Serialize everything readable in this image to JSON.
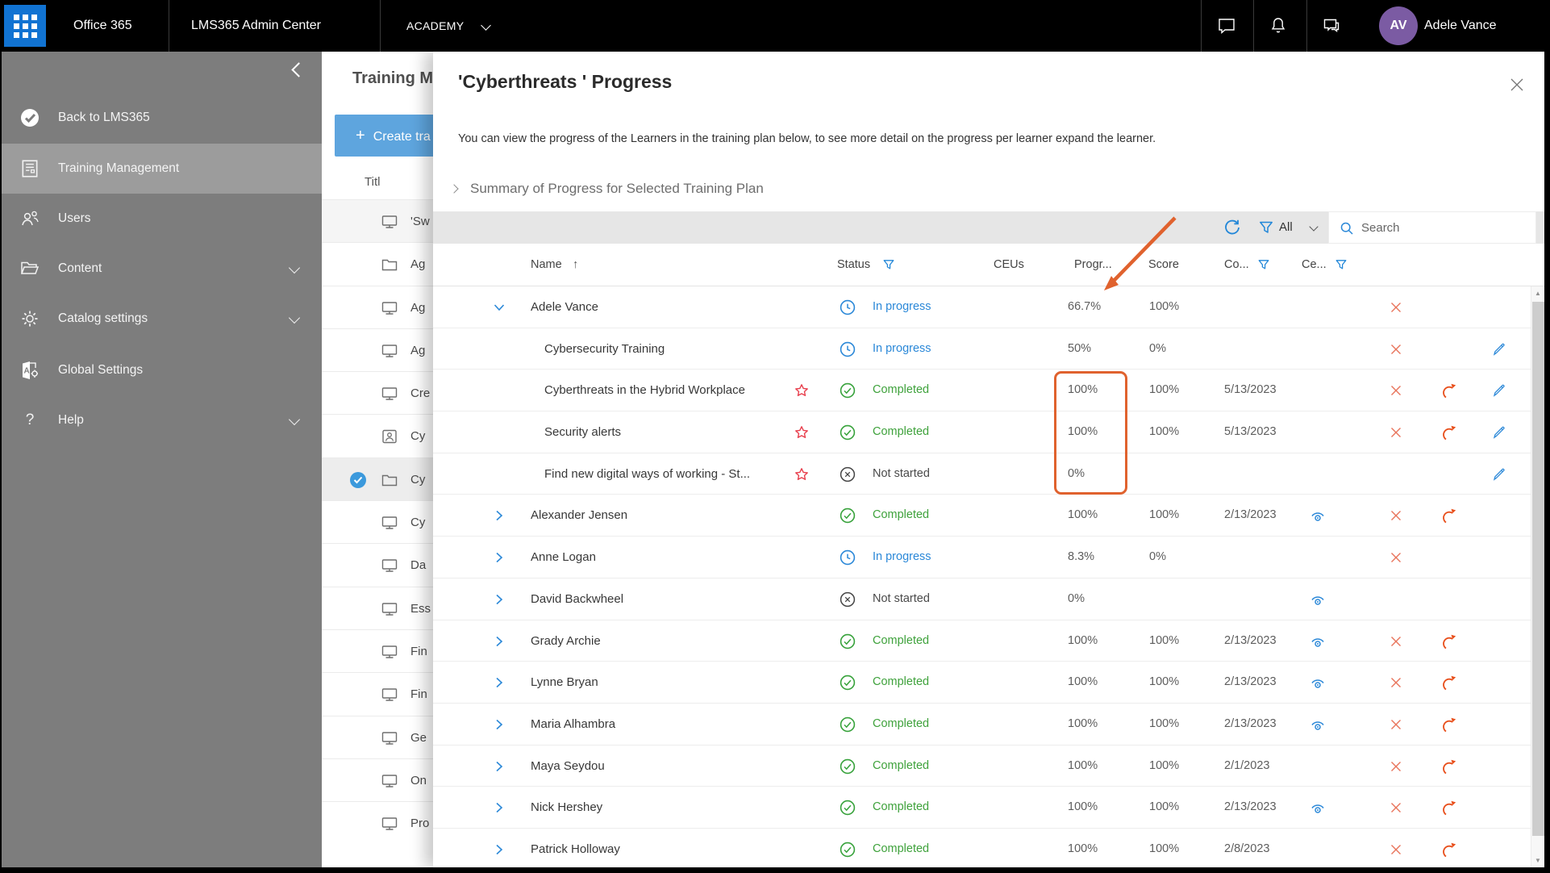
{
  "colors": {
    "accent_blue": "#2b88d8",
    "completed_green": "#3fa23c",
    "not_started_dark": "#4a4a4a",
    "remove_red": "#e8735a",
    "retake_orange": "#e84e1a",
    "annotation_orange": "#e0622e",
    "star_red": "#e8404e",
    "tile_blue": "#1173d2",
    "sidebar_gray": "#7d7d7d",
    "create_button_blue": "#5ea5de",
    "toolbar_gray": "#e6e6e6",
    "avatar_purple": "#7b5ba3"
  },
  "topbar": {
    "brand": "Office 365",
    "admin_center": "LMS365 Admin Center",
    "tenant": "ACADEMY",
    "user": {
      "initials": "AV",
      "name": "Adele Vance"
    }
  },
  "sidebar": {
    "items": [
      {
        "label": "Back to LMS365",
        "icon": "lms365-logo-icon"
      },
      {
        "label": "Training Management",
        "icon": "training-doc-icon",
        "selected": true
      },
      {
        "label": "Users",
        "icon": "users-icon"
      },
      {
        "label": "Content",
        "icon": "folder-icon",
        "expandable": true
      },
      {
        "label": "Catalog settings",
        "icon": "gear-icon",
        "expandable": true
      },
      {
        "label": "Global Settings",
        "icon": "global-settings-icon"
      },
      {
        "label": "Help",
        "icon": "help-icon",
        "expandable": true
      }
    ]
  },
  "training_list": {
    "title": "Training M",
    "create_button": "Create tra",
    "column_header": "Titl",
    "rows": [
      {
        "icon": "monitor",
        "text": "'Sw",
        "highlighted": true
      },
      {
        "icon": "folder",
        "text": "Ag"
      },
      {
        "icon": "monitor",
        "text": "Ag"
      },
      {
        "icon": "monitor",
        "text": "Ag"
      },
      {
        "icon": "monitor",
        "text": "Cre"
      },
      {
        "icon": "person",
        "text": "Cy"
      },
      {
        "icon": "folder",
        "text": "Cy",
        "selected": true
      },
      {
        "icon": "monitor",
        "text": "Cy"
      },
      {
        "icon": "monitor",
        "text": "Da"
      },
      {
        "icon": "monitor",
        "text": "Ess"
      },
      {
        "icon": "monitor",
        "text": "Fin"
      },
      {
        "icon": "monitor",
        "text": "Fin"
      },
      {
        "icon": "monitor",
        "text": "Ge"
      },
      {
        "icon": "monitor",
        "text": "On"
      },
      {
        "icon": "monitor",
        "text": "Pro"
      }
    ]
  },
  "panel": {
    "title": "'Cyberthreats ' Progress",
    "description": "You can view the progress of the Learners in the training plan below, to see more detail on the progress per learner expand the learner.",
    "summary_toggle": "Summary of Progress for Selected Training Plan",
    "toolbar": {
      "filter_label": "All",
      "search_placeholder": "Search"
    },
    "table": {
      "header": {
        "name": "Name",
        "sort_indicator": "↑",
        "status": "Status",
        "ceus": "CEUs",
        "progress": "Progr...",
        "score": "Score",
        "completion": "Co...",
        "certificate": "Ce..."
      },
      "rows": [
        {
          "expand": "expanded",
          "level": 0,
          "name": "Adele Vance",
          "star": false,
          "status_type": "in_progress",
          "status": "In progress",
          "progress": "66.7%",
          "score": "100%",
          "date": "",
          "eye": false,
          "x": true,
          "redo": false,
          "pencil": false
        },
        {
          "expand": "",
          "level": 1,
          "name": "Cybersecurity Training",
          "star": false,
          "status_type": "in_progress",
          "status": "In progress",
          "progress": "50%",
          "score": "0%",
          "date": "",
          "eye": false,
          "x": true,
          "redo": false,
          "pencil": true
        },
        {
          "expand": "",
          "level": 1,
          "name": "Cyberthreats in the Hybrid Workplace",
          "star": true,
          "status_type": "completed",
          "status": "Completed",
          "progress": "100%",
          "score": "100%",
          "date": "5/13/2023",
          "eye": false,
          "x": true,
          "redo": true,
          "pencil": true
        },
        {
          "expand": "",
          "level": 1,
          "name": "Security alerts",
          "star": true,
          "status_type": "completed",
          "status": "Completed",
          "progress": "100%",
          "score": "100%",
          "date": "5/13/2023",
          "eye": false,
          "x": true,
          "redo": true,
          "pencil": true
        },
        {
          "expand": "",
          "level": 1,
          "name": "Find new digital ways of working - St...",
          "star": true,
          "status_type": "not_started",
          "status": "Not started",
          "progress": "0%",
          "score": "",
          "date": "",
          "eye": false,
          "x": false,
          "redo": false,
          "pencil": true
        },
        {
          "expand": "collapsed",
          "level": 0,
          "name": "Alexander Jensen",
          "star": false,
          "status_type": "completed",
          "status": "Completed",
          "progress": "100%",
          "score": "100%",
          "date": "2/13/2023",
          "eye": true,
          "x": true,
          "redo": true,
          "pencil": false
        },
        {
          "expand": "collapsed",
          "level": 0,
          "name": "Anne Logan",
          "star": false,
          "status_type": "in_progress",
          "status": "In progress",
          "progress": "8.3%",
          "score": "0%",
          "date": "",
          "eye": false,
          "x": true,
          "redo": false,
          "pencil": false
        },
        {
          "expand": "collapsed",
          "level": 0,
          "name": "David Backwheel",
          "star": false,
          "status_type": "not_started",
          "status": "Not started",
          "progress": "0%",
          "score": "",
          "date": "",
          "eye": true,
          "x": false,
          "redo": false,
          "pencil": false
        },
        {
          "expand": "collapsed",
          "level": 0,
          "name": "Grady Archie",
          "star": false,
          "status_type": "completed",
          "status": "Completed",
          "progress": "100%",
          "score": "100%",
          "date": "2/13/2023",
          "eye": true,
          "x": true,
          "redo": true,
          "pencil": false
        },
        {
          "expand": "collapsed",
          "level": 0,
          "name": "Lynne Bryan",
          "star": false,
          "status_type": "completed",
          "status": "Completed",
          "progress": "100%",
          "score": "100%",
          "date": "2/13/2023",
          "eye": true,
          "x": true,
          "redo": true,
          "pencil": false
        },
        {
          "expand": "collapsed",
          "level": 0,
          "name": "Maria Alhambra",
          "star": false,
          "status_type": "completed",
          "status": "Completed",
          "progress": "100%",
          "score": "100%",
          "date": "2/13/2023",
          "eye": true,
          "x": true,
          "redo": true,
          "pencil": false
        },
        {
          "expand": "collapsed",
          "level": 0,
          "name": "Maya Seydou",
          "star": false,
          "status_type": "completed",
          "status": "Completed",
          "progress": "100%",
          "score": "100%",
          "date": "2/1/2023",
          "eye": false,
          "x": true,
          "redo": true,
          "pencil": false
        },
        {
          "expand": "collapsed",
          "level": 0,
          "name": "Nick Hershey",
          "star": false,
          "status_type": "completed",
          "status": "Completed",
          "progress": "100%",
          "score": "100%",
          "date": "2/13/2023",
          "eye": true,
          "x": true,
          "redo": true,
          "pencil": false
        },
        {
          "expand": "collapsed",
          "level": 0,
          "name": "Patrick Holloway",
          "star": false,
          "status_type": "completed",
          "status": "Completed",
          "progress": "100%",
          "score": "100%",
          "date": "2/8/2023",
          "eye": false,
          "x": true,
          "redo": true,
          "pencil": false
        }
      ]
    },
    "scrollbar": {
      "up": "▲",
      "down": "▼"
    }
  }
}
